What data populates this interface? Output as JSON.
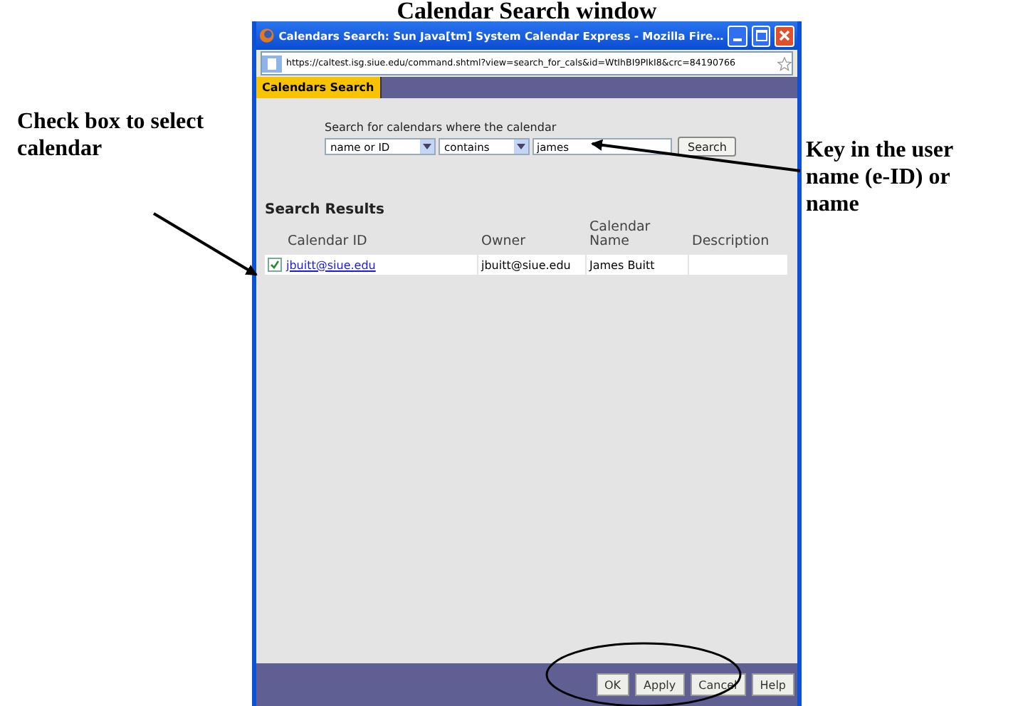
{
  "heading": "Calendar Search window",
  "annotations": [
    {
      "text": "Check box to select calendar"
    },
    {
      "text": "Key in the user name (e-ID) or name"
    }
  ],
  "window": {
    "title": "Calendars Search: Sun Java[tm] System Calendar Express - Mozilla Fire…",
    "url": "https://caltest.isg.siue.edu/command.shtml?view=search_for_cals&id=WtIhBI9PIkI8&crc=84190766"
  },
  "tabs": [
    {
      "label": "Calendars Search",
      "selected": true
    }
  ],
  "search": {
    "prompt": "Search for calendars where the calendar",
    "field_select": "name or ID",
    "operator_select": "contains",
    "query": "james",
    "button": "Search"
  },
  "results": {
    "title": "Search Results",
    "columns": [
      "Calendar ID",
      "Owner",
      "Calendar Name",
      "Description"
    ],
    "rows": [
      {
        "checked": true,
        "calendar_id": "jbuitt@siue.edu",
        "owner": "jbuitt@siue.edu",
        "calendar_name": "James Buitt"
      }
    ]
  },
  "buttons": [
    "OK",
    "Apply",
    "Cancel",
    "Help"
  ]
}
